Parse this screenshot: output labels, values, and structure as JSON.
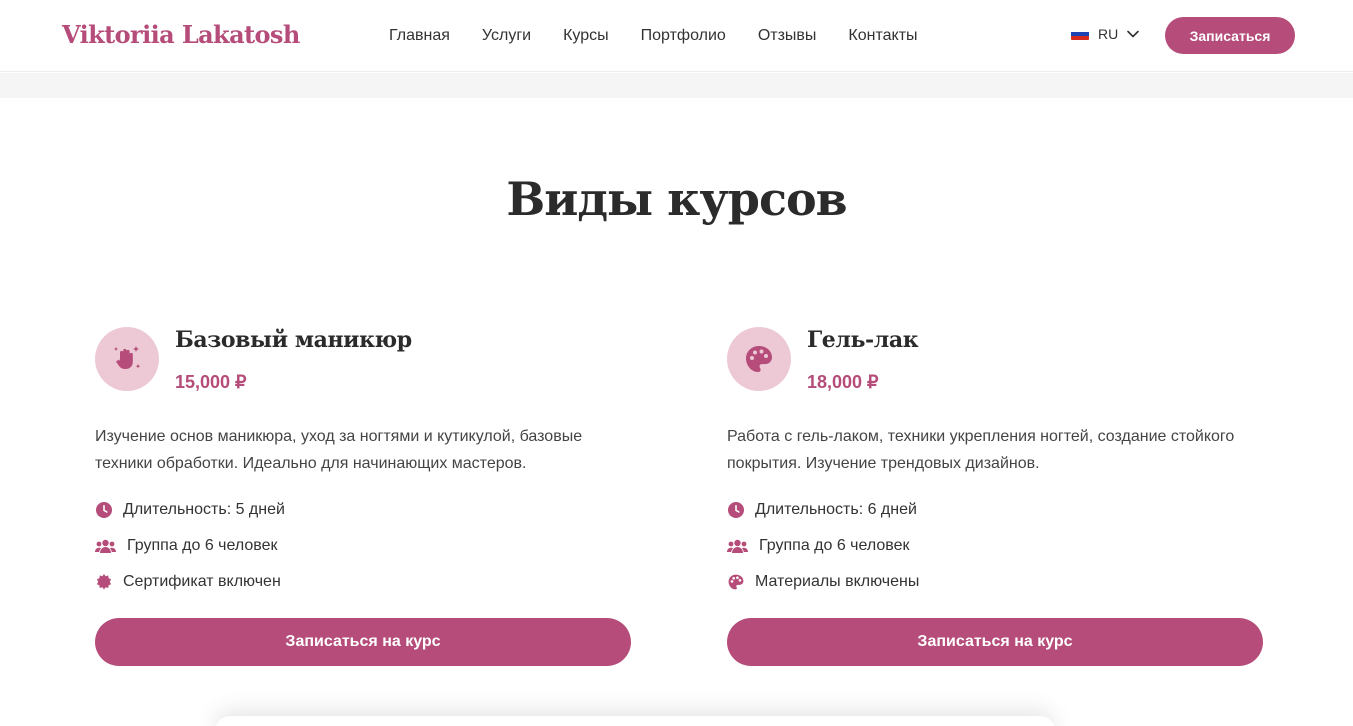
{
  "header": {
    "logo": "Viktoriia Lakatosh",
    "nav": [
      "Главная",
      "Услуги",
      "Курсы",
      "Портфолио",
      "Отзывы",
      "Контакты"
    ],
    "language": "RU",
    "cta_label": "Записаться"
  },
  "section": {
    "title": "Виды курсов"
  },
  "colors": {
    "accent": "#b54c79",
    "icon_bg": "#ecc9d5"
  },
  "courses": [
    {
      "icon": "hand-sparkles-icon",
      "title": "Базовый маникюр",
      "price": "15,000 ₽",
      "description": "Изучение основ маникюра, уход за ногтями и кутикулой, базовые техники обработки. Идеально для начинающих мастеров.",
      "features": [
        {
          "icon": "clock-icon",
          "text": "Длительность: 5 дней"
        },
        {
          "icon": "users-icon",
          "text": "Группа до 6 человек"
        },
        {
          "icon": "certificate-icon",
          "text": "Сертификат включен"
        }
      ],
      "button": "Записаться на курс"
    },
    {
      "icon": "palette-icon",
      "title": "Гель-лак",
      "price": "18,000 ₽",
      "description": "Работа с гель-лаком, техники укрепления ногтей, создание стойкого покрытия. Изучение трендовых дизайнов.",
      "features": [
        {
          "icon": "clock-icon",
          "text": "Длительность: 6 дней"
        },
        {
          "icon": "users-icon",
          "text": "Группа до 6 человек"
        },
        {
          "icon": "palette-icon",
          "text": "Материалы включены"
        }
      ],
      "button": "Записаться на курс"
    }
  ]
}
